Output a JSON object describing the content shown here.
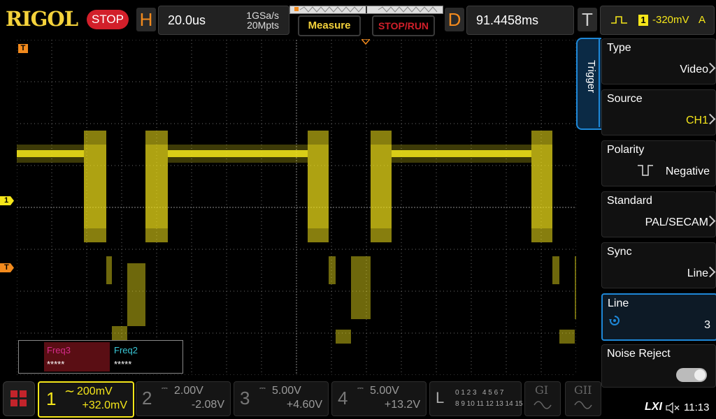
{
  "header": {
    "brand": "RIGOL",
    "run_state": "STOP",
    "horizontal": {
      "letter": "H",
      "timebase": "20.0us",
      "sample_rate": "1GSa/s",
      "memory_depth": "20Mpts"
    },
    "measure_label": "Measure",
    "stoprun_label": "STOP/RUN",
    "delay": {
      "letter": "D",
      "value": "91.4458ms"
    },
    "trigger": {
      "letter": "T",
      "channel": "1",
      "level": "-320mV",
      "mode": "A"
    }
  },
  "screen": {
    "trigger_marker_top": "T",
    "ch1_marker": "1",
    "trigger_level_marker": "T",
    "counters": [
      {
        "name": "Freq3",
        "value": "*****",
        "color": "#d62c8c"
      },
      {
        "name": "Freq2",
        "value": "*****",
        "color": "#39c8d8"
      }
    ]
  },
  "trigger_menu": {
    "tab_label": "Trigger",
    "items": [
      {
        "label": "Type",
        "value": "Video"
      },
      {
        "label": "Source",
        "value": "CH1"
      },
      {
        "label": "Polarity",
        "value": "Negative"
      },
      {
        "label": "Standard",
        "value": "PAL/SECAM"
      },
      {
        "label": "Sync",
        "value": "Line"
      },
      {
        "label": "Line",
        "value": "3"
      },
      {
        "label": "Noise Reject",
        "value": ""
      }
    ]
  },
  "channels": [
    {
      "num": "1",
      "scale": "200mV",
      "offset": "+32.0mV",
      "active": true,
      "color": "#f5e61a"
    },
    {
      "num": "2",
      "scale": "2.00V",
      "offset": "-2.08V",
      "active": false
    },
    {
      "num": "3",
      "scale": "5.00V",
      "offset": "+4.60V",
      "active": false
    },
    {
      "num": "4",
      "scale": "5.00V",
      "offset": "+13.2V",
      "active": false
    }
  ],
  "logic": {
    "letter": "L",
    "row1": "0 1 2 3   4 5 6 7",
    "row2": "8 9 10 11 12 13 14 15"
  },
  "generators": [
    "GI",
    "GII"
  ],
  "status": {
    "lxi": "LXI",
    "time": "11:13"
  },
  "colors": {
    "accent": "#f28a1d",
    "ch1": "#f5e61a",
    "menu_active": "#1e88d8",
    "stop": "#d21f2a"
  }
}
